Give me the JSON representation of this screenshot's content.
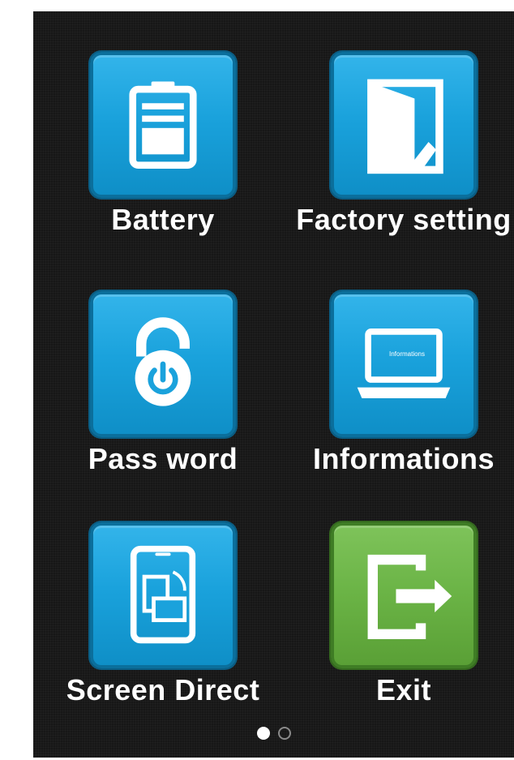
{
  "menu": {
    "items": [
      {
        "label": "Battery",
        "icon": "battery-icon",
        "color": "#1aa2dc"
      },
      {
        "label": "Factory setting",
        "icon": "door-icon",
        "color": "#1aa2dc"
      },
      {
        "label": "Pass word",
        "icon": "lock-icon",
        "color": "#1aa2dc"
      },
      {
        "label": "Informations",
        "icon": "laptop-icon",
        "color": "#1aa2dc",
        "icon_text": "Informations"
      },
      {
        "label": "Screen Direct",
        "icon": "screen-rotate-icon",
        "color": "#1aa2dc"
      },
      {
        "label": "Exit",
        "icon": "exit-icon",
        "color": "#6ab345"
      }
    ]
  },
  "pager": {
    "pages": 2,
    "current": 1
  },
  "colors": {
    "background": "#171717",
    "tile_blue": "#1aa2dc",
    "tile_green": "#6ab345",
    "label": "#ffffff"
  }
}
